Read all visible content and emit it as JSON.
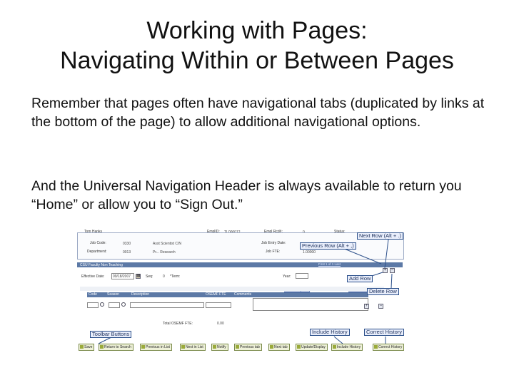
{
  "slide": {
    "title_line1": "Working with Pages:",
    "title_line2": "Navigating Within or Between Pages",
    "para1": "Remember that pages often have navigational tabs (duplicated by links at the bottom of the page) to allow additional navigational options.",
    "para2": "And the Universal Navigation Header is always available to return you “Home” or allow you to “Sign Out.”"
  },
  "screenshot": {
    "header": {
      "name_label": "Tom Hanks",
      "empl_id_label": "EmplID:",
      "empl_id_value": "TL000012",
      "empl_rcd_label": "Empl Rcd#:",
      "empl_rcd_value": "0",
      "status_label": "Status:",
      "job_code_label": "Job Code:",
      "job_code_value": "0330",
      "job_code_desc": "Asst Scientist C/N",
      "job_entry_label": "Job Entry Date:",
      "department_label": "Department:",
      "department_value": "0013",
      "department_desc": "Pr... Research",
      "job_fte_label": "Job FTE:",
      "job_fte_value": "1.00000"
    },
    "section_title": "CSU Faculty Non Teaching",
    "section_links": "First  1 of 1  Last",
    "effective_date_label": "Effective Date:",
    "effective_date_value": "09/18/2007",
    "seq_label": "Seq:",
    "seq_value": "0",
    "term_label": "*Term:",
    "year_label": "Year:",
    "grid_links": "Customize | Find |",
    "grid_nav": "First  1 of 1  Last",
    "columns": [
      "Code",
      "Season",
      "Description",
      "OSEMF FTE",
      "Comments"
    ],
    "total_label": "Total OSEMF FTE:",
    "total_value": "0.00",
    "toolbar": [
      "Save",
      "Return to Search",
      "Previous in List",
      "Next in List",
      "Notify",
      "Previous tab",
      "Next tab",
      "Update/Display",
      "Include History",
      "Correct History"
    ],
    "callouts": {
      "next_row": "Next Row (Alt + .)",
      "previous_row": "Previous Row (Alt + ,)",
      "add_row": "Add Row",
      "delete_row": "Delete Row",
      "toolbar_buttons": "Toolbar Buttons",
      "include_history": "Include History",
      "correct_history": "Correct History"
    },
    "colors": {
      "bar": "#5c79a6",
      "callout_border": "#2b4f8a",
      "toolbar_button": "#eef1d8"
    },
    "icons": [
      "lookup-icon",
      "calendar-icon",
      "add-row-icon",
      "delete-row-icon"
    ]
  }
}
